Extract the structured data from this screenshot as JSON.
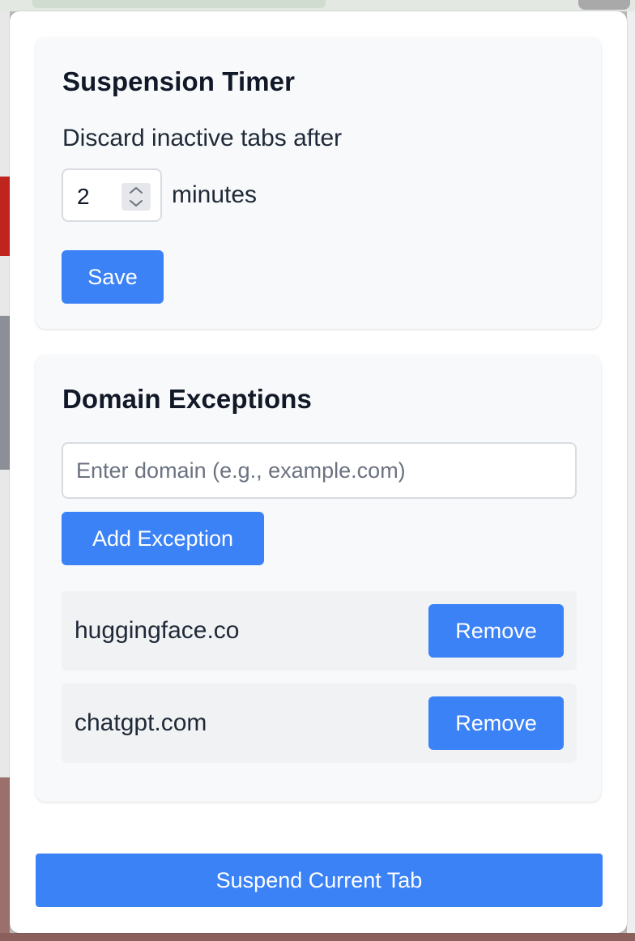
{
  "timer": {
    "title": "Suspension Timer",
    "label": "Discard inactive tabs after",
    "value": "2",
    "unit": "minutes",
    "save_label": "Save"
  },
  "exceptions": {
    "title": "Domain Exceptions",
    "input_placeholder": "Enter domain (e.g., example.com)",
    "input_value": "",
    "add_label": "Add Exception",
    "items": [
      {
        "domain": "huggingface.co",
        "remove_label": "Remove"
      },
      {
        "domain": "chatgpt.com",
        "remove_label": "Remove"
      }
    ]
  },
  "footer": {
    "suspend_label": "Suspend Current Tab"
  },
  "colors": {
    "accent": "#3b82f6",
    "card_background": "#f8f9fa",
    "item_background": "#f1f2f4",
    "heading_text": "#111827"
  },
  "icons": {
    "spinner": "up-down-chevron-icon"
  }
}
